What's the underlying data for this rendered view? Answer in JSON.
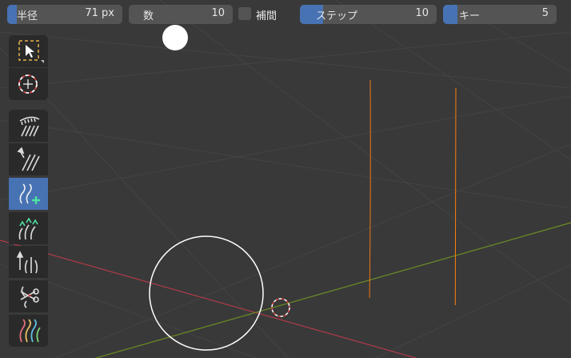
{
  "header": {
    "radius": {
      "label": "半径",
      "value": "71 px",
      "fill": 0.08
    },
    "count": {
      "label": "数",
      "value": "10"
    },
    "interpolate": {
      "label": "補間",
      "checked": false
    },
    "steps": {
      "label": "ステップ",
      "value": "10",
      "fill": 0.17
    },
    "keys": {
      "label": "キー",
      "value": "5",
      "fill": 0.13
    }
  },
  "toolbar": {
    "active_tool": "add-hair-icon",
    "tools": [
      "select-box-icon",
      "cursor-icon",
      "comb-icon",
      "smooth-icon",
      "add-hair-icon",
      "length-icon",
      "puff-icon",
      "cut-icon",
      "weight-icon"
    ]
  },
  "colors": {
    "hair": "#ff7f0e",
    "background": "#393939",
    "accent": "#4772b3",
    "x_axis": "#b03a48",
    "y_axis": "#6b8e23"
  }
}
